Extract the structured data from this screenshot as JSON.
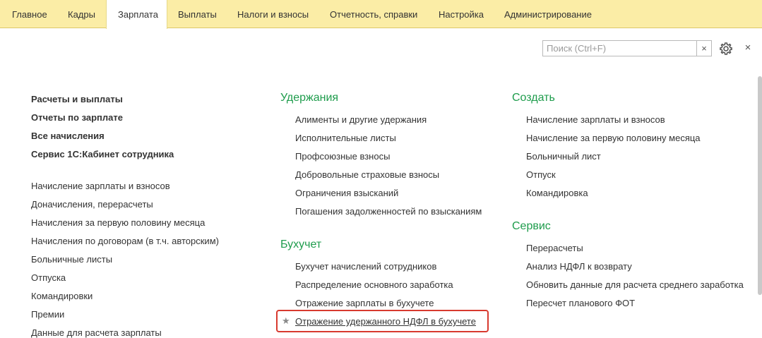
{
  "tabs": [
    "Главное",
    "Кадры",
    "Зарплата",
    "Выплаты",
    "Налоги и взносы",
    "Отчетность, справки",
    "Настройка",
    "Администрирование"
  ],
  "search": {
    "placeholder": "Поиск (Ctrl+F)",
    "clear": "×"
  },
  "close": "×",
  "left": {
    "bold_links": [
      "Расчеты и выплаты",
      "Отчеты по зарплате",
      "Все начисления",
      "Сервис 1С:Кабинет сотрудника"
    ],
    "links": [
      "Начисление зарплаты и взносов",
      "Доначисления, перерасчеты",
      "Начисления за первую половину месяца",
      "Начисления по договорам (в т.ч. авторским)",
      "Больничные листы",
      "Отпуска",
      "Командировки",
      "Премии",
      "Данные для расчета зарплаты"
    ]
  },
  "middle": {
    "section1": {
      "title": "Удержания",
      "items": [
        "Алименты и другие удержания",
        "Исполнительные листы",
        "Профсоюзные взносы",
        "Добровольные страховые взносы",
        "Ограничения взысканий",
        "Погашения задолженностей по взысканиям"
      ]
    },
    "section2": {
      "title": "Бухучет",
      "items": [
        "Бухучет начислений сотрудников",
        "Распределение основного заработка",
        "Отражение зарплаты в бухучете",
        "Отражение удержанного НДФЛ в бухучете"
      ]
    }
  },
  "right": {
    "section1": {
      "title": "Создать",
      "items": [
        "Начисление зарплаты и взносов",
        "Начисление за первую половину месяца",
        "Больничный лист",
        "Отпуск",
        "Командировка"
      ]
    },
    "section2": {
      "title": "Сервис",
      "items": [
        "Перерасчеты",
        "Анализ НДФЛ к возврату",
        "Обновить данные для расчета среднего заработка",
        "Пересчет планового ФОТ"
      ]
    }
  },
  "star_icon": "★"
}
